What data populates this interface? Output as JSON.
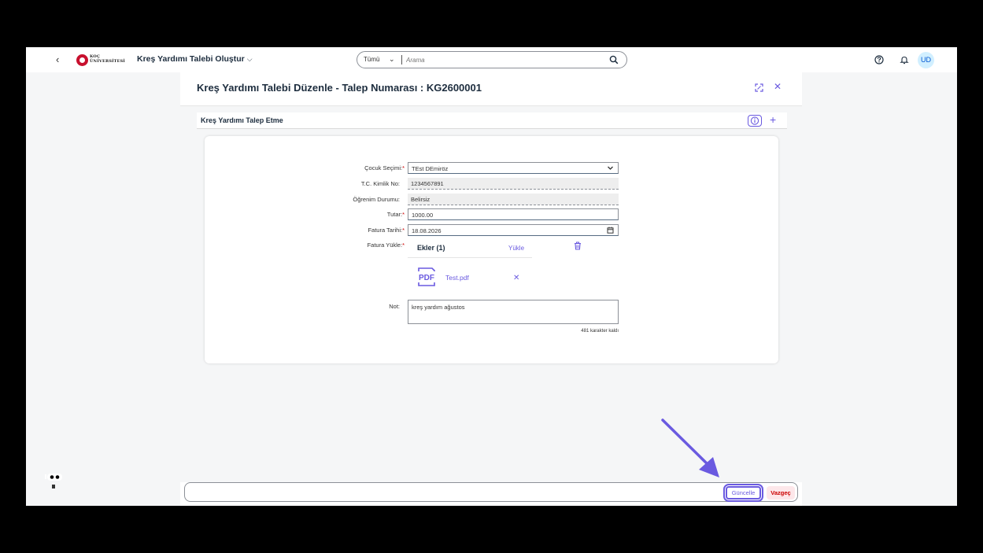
{
  "shell": {
    "back_icon": "chevron-left-icon",
    "logo_line1": "KOÇ",
    "logo_line2": "ÜNİVERSİTESİ",
    "app_title": "Kreş Yardımı Talebi Oluştur",
    "app_title_chevron": "⌵",
    "search_scope": "Tümü",
    "search_placeholder": "Arama",
    "avatar_initials": "UD"
  },
  "page": {
    "title": "Kreş Yardımı Talebi Düzenle - Talep Numarası : KG2600001",
    "section_title": "Kreş Yardımı Talep Etme"
  },
  "form": {
    "child_label": "Çocuk Seçimi:",
    "child_value": "TEst DEmiröz",
    "tc_label": "T.C. Kimlik No:",
    "tc_value": "1234567891",
    "education_label": "Öğrenim Durumu:",
    "education_value": "Belirsiz",
    "amount_label": "Tutar:",
    "amount_value": "1000.00",
    "invoice_date_label": "Fatura Tarihi:",
    "invoice_date_value": "18.08.2026",
    "invoice_upload_label": "Fatura Yükle:",
    "required_mark": "*",
    "attachments_title": "Ekler (1)",
    "upload_link": "Yükle",
    "file_name": "Test.pdf",
    "note_label": "Not:",
    "note_value": "kreş yardım ağustos",
    "char_count": "481 karakter kaldı"
  },
  "footer": {
    "update_label": "Güncelle",
    "cancel_label": "Vazgeç"
  },
  "colors": {
    "accent": "#6a5ae0",
    "danger": "#cc0000",
    "brand_red": "#c8102e"
  }
}
